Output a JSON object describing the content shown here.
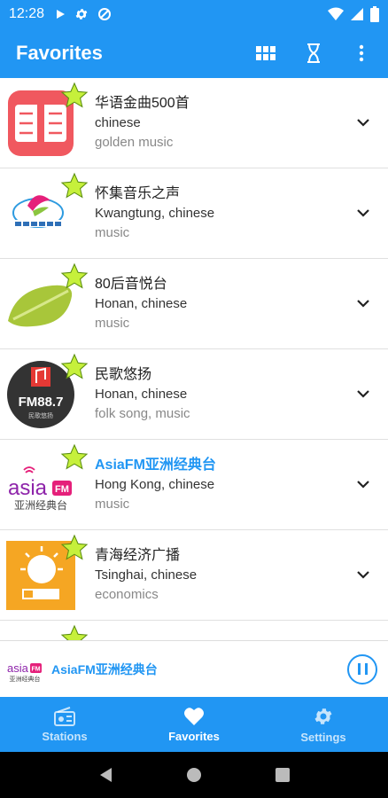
{
  "status_bar": {
    "time": "12:28"
  },
  "app_bar": {
    "title": "Favorites",
    "icons": [
      "grid-view-icon",
      "timer-icon",
      "more-vert-icon"
    ]
  },
  "stations": [
    {
      "name": "华语金曲500首",
      "region": "chinese",
      "tags": "golden music",
      "active": false
    },
    {
      "name": "怀集音乐之声",
      "region": "Kwangtung, chinese",
      "tags": "music",
      "active": false
    },
    {
      "name": "80后音悦台",
      "region": "Honan, chinese",
      "tags": "music",
      "active": false
    },
    {
      "name": "民歌悠扬",
      "region": "Honan, chinese",
      "tags": "folk song, music",
      "active": false
    },
    {
      "name": "AsiaFM亚洲经典台",
      "region": "Hong Kong, chinese",
      "tags": "music",
      "active": true
    },
    {
      "name": "青海经济广播",
      "region": "Tsinghai, chinese",
      "tags": "economics",
      "active": false
    }
  ],
  "logos": {
    "s4": {
      "top": "FM88.7",
      "bottom": "民歌悠扬"
    },
    "s5": {
      "word": "asia",
      "fm": "FM",
      "sub": "亚洲经典台"
    }
  },
  "player": {
    "station": "AsiaFM亚洲经典台"
  },
  "bottom_nav": {
    "stations": "Stations",
    "favorites": "Favorites",
    "settings": "Settings"
  },
  "colors": {
    "primary": "#2196F3",
    "star": "#C6F03B"
  }
}
